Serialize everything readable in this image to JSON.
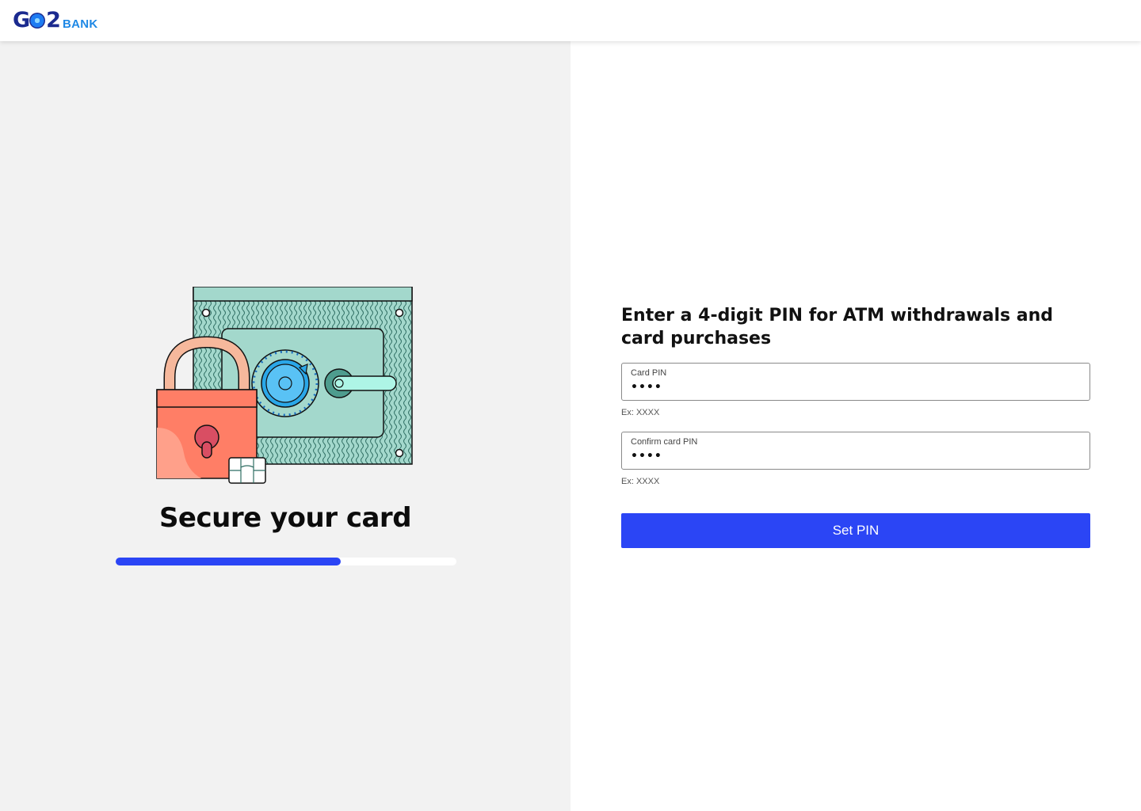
{
  "header": {
    "logo_main": "GO2",
    "logo_bank": "BANK"
  },
  "hero": {
    "title": "Secure your card",
    "progress_fraction": 0.66,
    "illustration_icon": "lock-safe-card-illustration"
  },
  "form": {
    "title": "Enter a 4-digit PIN for ATM withdrawals and card purchases",
    "pin": {
      "label": "Card PIN",
      "value": "••••",
      "hint": "Ex: XXXX"
    },
    "confirm_pin": {
      "label": "Confirm card PIN",
      "value": "••••",
      "hint": "Ex: XXXX"
    },
    "submit_label": "Set PIN"
  },
  "colors": {
    "accent": "#2b45f5",
    "brand_navy": "#1b2a8f",
    "brand_blue": "#1e88e5"
  }
}
